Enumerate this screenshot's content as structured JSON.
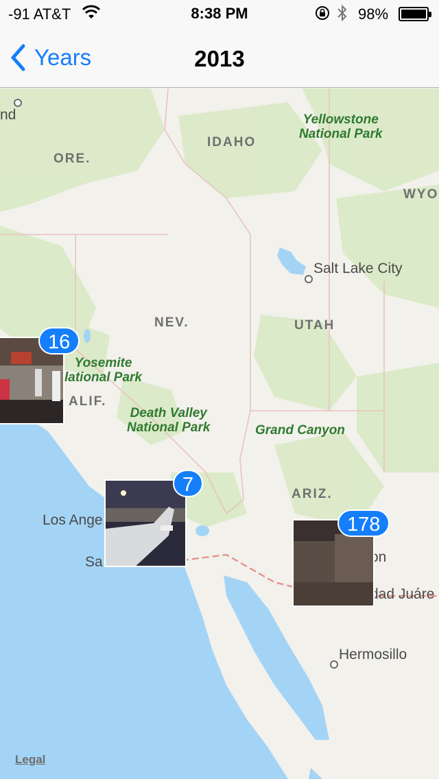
{
  "status_bar": {
    "carrier": "-91 AT&T",
    "time": "8:38 PM",
    "battery_percent": "98%",
    "battery_level": 0.98
  },
  "nav": {
    "back_label": "Years",
    "title": "2013",
    "accent_color": "#157efb"
  },
  "map": {
    "states": [
      "ORE.",
      "IDAHO",
      "WYO",
      "NEV.",
      "UTAH",
      "ALIF.",
      "ARIZ."
    ],
    "cities": [
      "nd",
      "Salt Lake City",
      "Los Ange",
      "Sa",
      "on",
      "dad Juáre",
      "Hermosillo"
    ],
    "parks": [
      [
        "Yellowstone",
        "National Park"
      ],
      [
        "Yosemite",
        "lational Park"
      ],
      [
        "Death Valley",
        "National Park"
      ],
      [
        "Grand Canyon"
      ]
    ],
    "land_color": "#f3f1ec",
    "water_color": "#a4d4f5",
    "park_color": "#d7e9c4"
  },
  "clusters": [
    {
      "count": "16",
      "location": "California"
    },
    {
      "count": "7",
      "location": "Los Angeles"
    },
    {
      "count": "178",
      "location": "Arizona"
    }
  ],
  "legal": "Legal"
}
